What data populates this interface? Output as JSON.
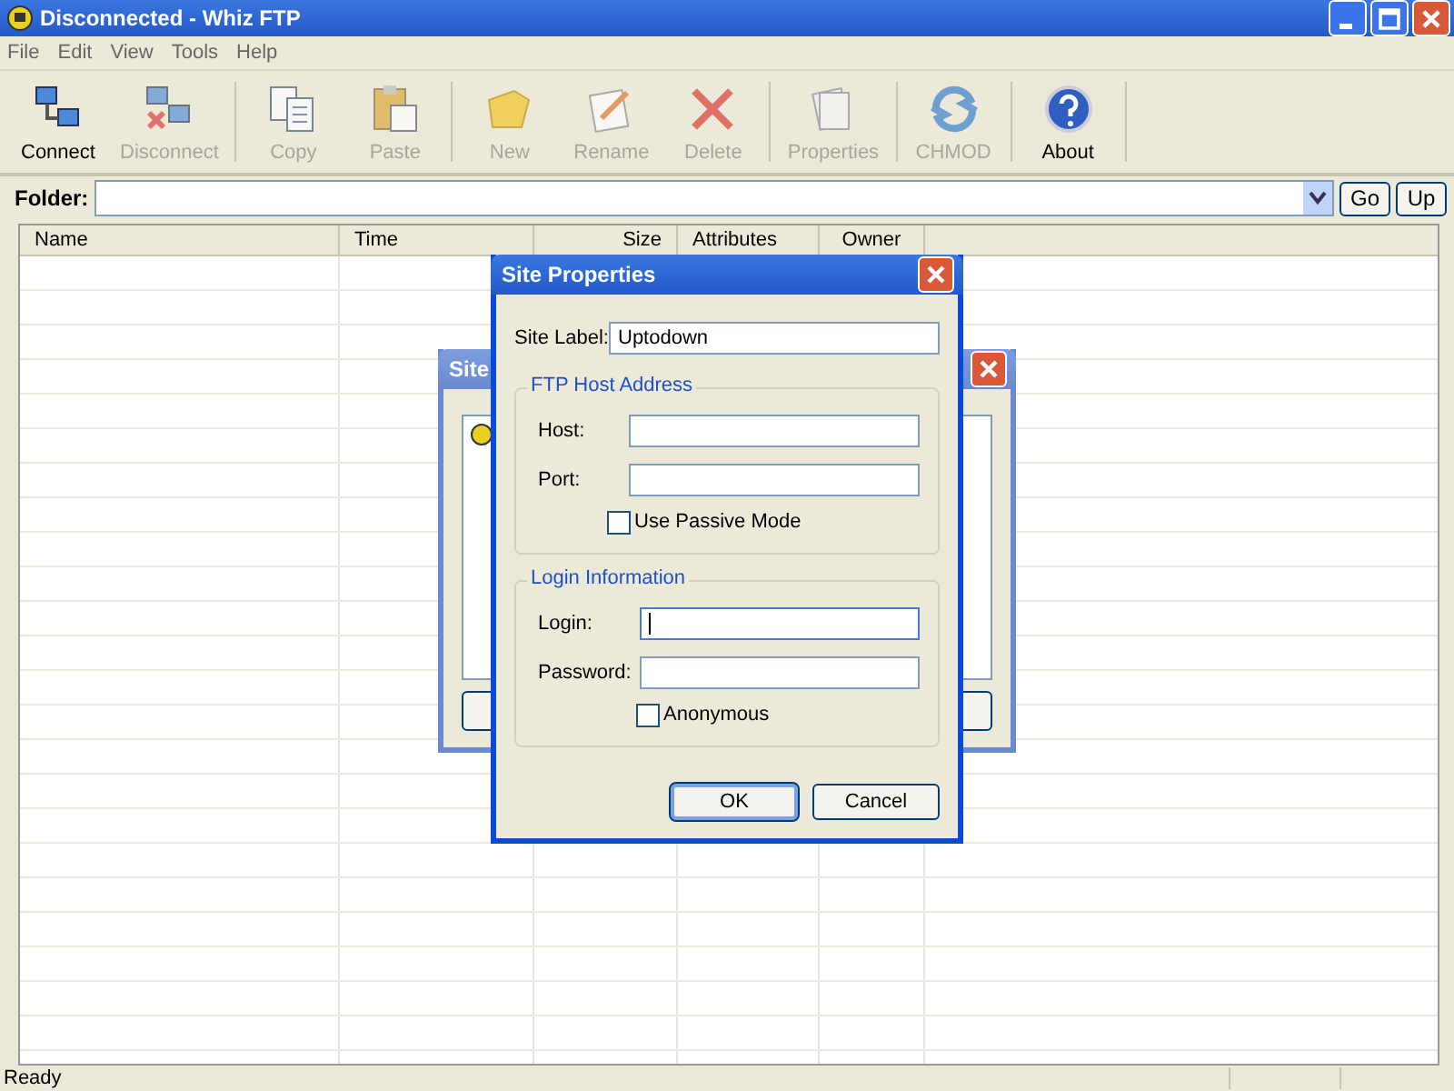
{
  "window": {
    "title": "Disconnected - Whiz FTP"
  },
  "menu": [
    "File",
    "Edit",
    "View",
    "Tools",
    "Help"
  ],
  "toolbar": [
    [
      {
        "label": "Connect",
        "disabled": false
      },
      {
        "label": "Disconnect",
        "disabled": true
      }
    ],
    [
      {
        "label": "Copy",
        "disabled": true
      },
      {
        "label": "Paste",
        "disabled": true
      }
    ],
    [
      {
        "label": "New",
        "disabled": true
      },
      {
        "label": "Rename",
        "disabled": true
      },
      {
        "label": "Delete",
        "disabled": true
      }
    ],
    [
      {
        "label": "Properties",
        "disabled": true
      }
    ],
    [
      {
        "label": "CHMOD",
        "disabled": true
      }
    ],
    [
      {
        "label": "About",
        "disabled": false
      }
    ]
  ],
  "folder": {
    "label": "Folder:",
    "go": "Go",
    "up": "Up"
  },
  "table": {
    "columns": [
      "Name",
      "Time",
      "Size",
      "Attributes",
      "Owner"
    ]
  },
  "status_bar": "Ready",
  "back_dialog": {
    "title": "Site"
  },
  "dialog": {
    "title": "Site Properties",
    "site_label": {
      "label": "Site Label:",
      "value": "Uptodown"
    },
    "host_group": {
      "title": "FTP Host Address",
      "fields": [
        {
          "label": "Host:",
          "focused": false
        },
        {
          "label": "Port:",
          "focused": false
        }
      ],
      "checkbox": {
        "label": "Use Passive Mode",
        "checked": false
      }
    },
    "login_group": {
      "title": "Login Information",
      "fields": [
        {
          "label": "Login:",
          "focused": true
        },
        {
          "label": "Password:",
          "focused": false
        }
      ],
      "checkbox": {
        "label": "Anonymous",
        "checked": false
      }
    },
    "buttons": [
      "OK",
      "Cancel"
    ]
  }
}
